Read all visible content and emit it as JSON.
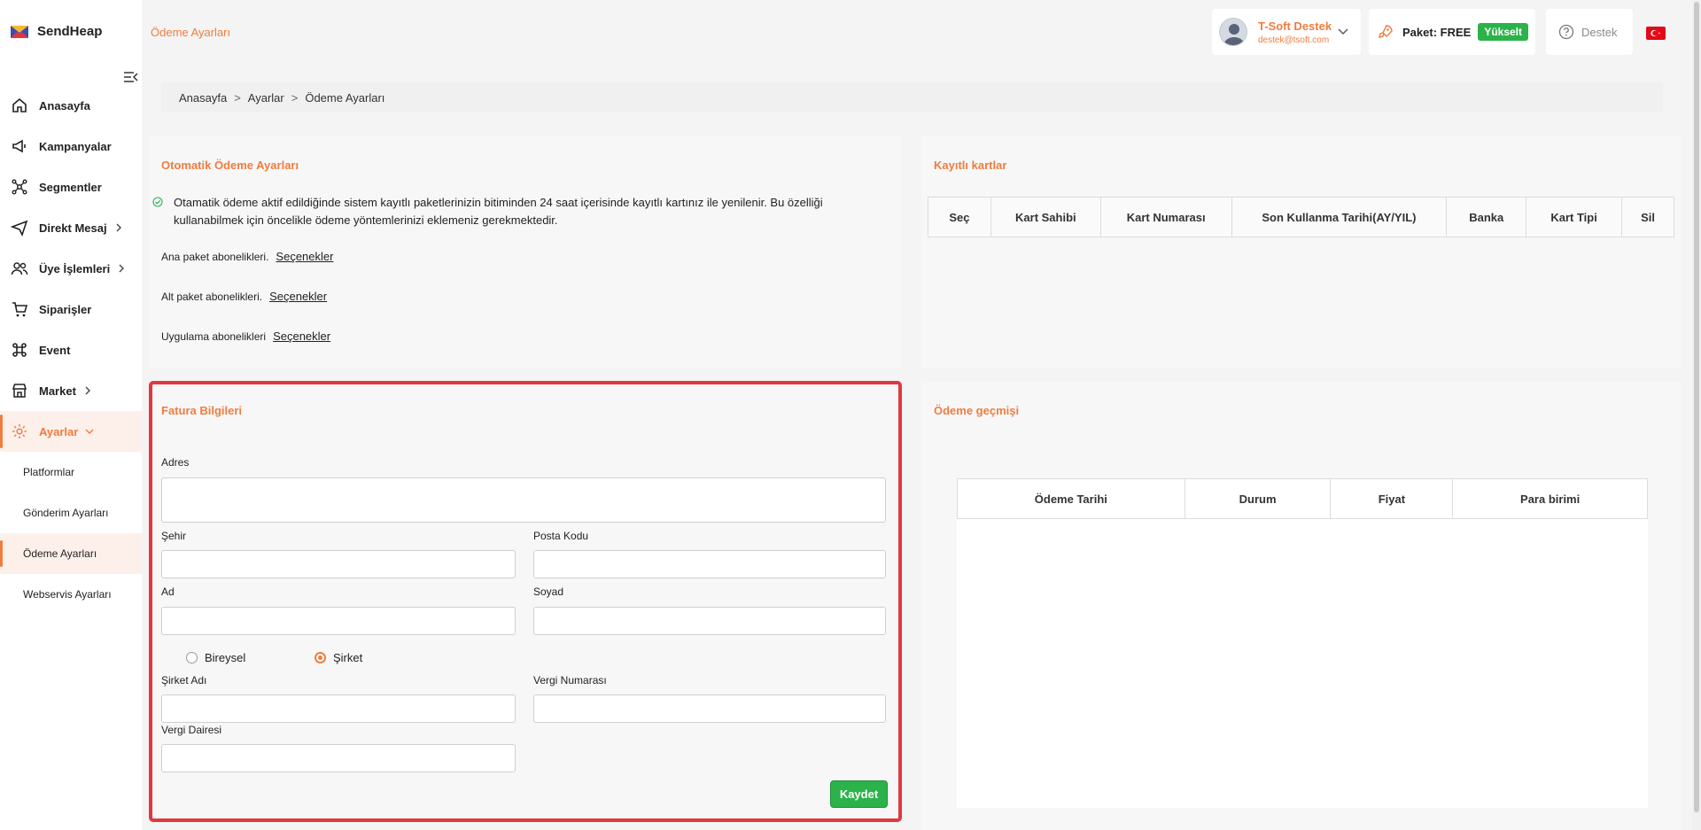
{
  "app": {
    "name": "SendHeap"
  },
  "header": {
    "page_title": "Ödeme Ayarları",
    "user": {
      "name": "T-Soft Destek",
      "email": "destek@tsoft.com"
    },
    "plan": {
      "label": "Paket: FREE",
      "upgrade": "Yükselt"
    },
    "support": "Destek"
  },
  "sidebar": {
    "items": [
      {
        "label": "Anasayfa",
        "icon": "home-icon"
      },
      {
        "label": "Kampanyalar",
        "icon": "megaphone-icon"
      },
      {
        "label": "Segmentler",
        "icon": "segments-icon"
      },
      {
        "label": "Direkt Mesaj",
        "icon": "send-icon"
      },
      {
        "label": "Üye İşlemleri",
        "icon": "users-icon"
      },
      {
        "label": "Siparişler",
        "icon": "cart-icon"
      },
      {
        "label": "Event",
        "icon": "command-icon"
      },
      {
        "label": "Market",
        "icon": "store-icon"
      },
      {
        "label": "Ayarlar",
        "icon": "gear-icon"
      }
    ],
    "submenu": [
      "Platformlar",
      "Gönderim Ayarları",
      "Ödeme Ayarları",
      "Webservis Ayarları"
    ]
  },
  "breadcrumb": [
    "Anasayfa",
    "Ayarlar",
    "Ödeme Ayarları"
  ],
  "auto_payment": {
    "title": "Otomatik Ödeme Ayarları",
    "info": "Otamatik ödeme aktif edildiğinde sistem kayıtlı paketlerinizin bitiminden 24 saat içerisinde kayıtlı kartınız ile yenilenir. Bu özelliği kullanabilmek için öncelikle ödeme yöntemlerinizi eklemeniz gerekmektedir.",
    "rows": [
      {
        "label": "Ana paket abonelikleri.",
        "link": "Seçenekler"
      },
      {
        "label": "Alt paket abonelikleri.",
        "link": "Seçenekler"
      },
      {
        "label": "Uygulama abonelikleri",
        "link": "Seçenekler"
      }
    ]
  },
  "saved_cards": {
    "title": "Kayıtlı kartlar",
    "columns": [
      "Seç",
      "Kart Sahibi",
      "Kart Numarası",
      "Son Kullanma Tarihi(AY/YIL)",
      "Banka",
      "Kart Tipi",
      "Sil"
    ]
  },
  "invoice": {
    "title": "Fatura Bilgileri",
    "address": "Adres",
    "city": "Şehir",
    "postal_code": "Posta Kodu",
    "first_name": "Ad",
    "last_name": "Soyad",
    "type_individual": "Bireysel",
    "type_company": "Şirket",
    "selected_type": "Şirket",
    "company_name": "Şirket Adı",
    "tax_number": "Vergi Numarası",
    "tax_office": "Vergi Dairesi",
    "save": "Kaydet"
  },
  "payment_history": {
    "title": "Ödeme geçmişi",
    "columns": [
      "Ödeme Tarihi",
      "Durum",
      "Fiyat",
      "Para birimi"
    ]
  },
  "colors": {
    "accent": "#f07c3e",
    "success": "#2bb34a",
    "highlight": "#e0383e"
  }
}
